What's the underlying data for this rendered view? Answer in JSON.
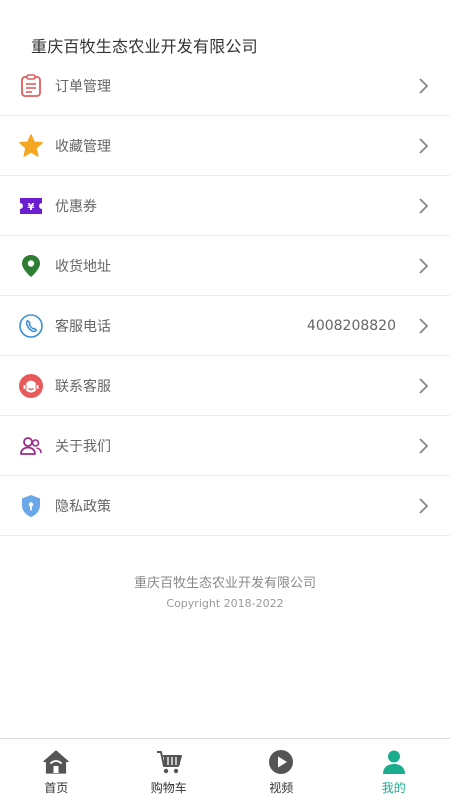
{
  "header": {
    "company_name": "重庆百牧生态农业开发有限公司"
  },
  "menu": {
    "items": [
      {
        "label": "订单管理",
        "icon": "order-list-icon"
      },
      {
        "label": "收藏管理",
        "icon": "star-icon"
      },
      {
        "label": "优惠券",
        "icon": "coupon-icon"
      },
      {
        "label": "收货地址",
        "icon": "location-pin-icon"
      },
      {
        "label": "客服电话",
        "icon": "phone-icon",
        "value": "4008208820"
      },
      {
        "label": "联系客服",
        "icon": "customer-service-icon"
      },
      {
        "label": "关于我们",
        "icon": "users-icon"
      },
      {
        "label": "隐私政策",
        "icon": "shield-icon"
      }
    ]
  },
  "footer": {
    "company": "重庆百牧生态农业开发有限公司",
    "copyright": "Copyright 2018-2022"
  },
  "tabbar": {
    "tabs": [
      {
        "label": "首页",
        "icon": "home-icon"
      },
      {
        "label": "购物车",
        "icon": "cart-icon"
      },
      {
        "label": "视频",
        "icon": "play-icon"
      },
      {
        "label": "我的",
        "icon": "person-icon",
        "active": true
      }
    ]
  },
  "colors": {
    "accent": "#1aad8d",
    "order_icon": "#e45c5c",
    "star_icon": "#f5a623",
    "coupon_icon": "#6b1fd1",
    "location_icon": "#2e7d32",
    "phone_icon": "#3a8fd8",
    "service_icon": "#e85a5a",
    "users_icon": "#9c2a8c",
    "shield_icon": "#6aa7e8"
  }
}
